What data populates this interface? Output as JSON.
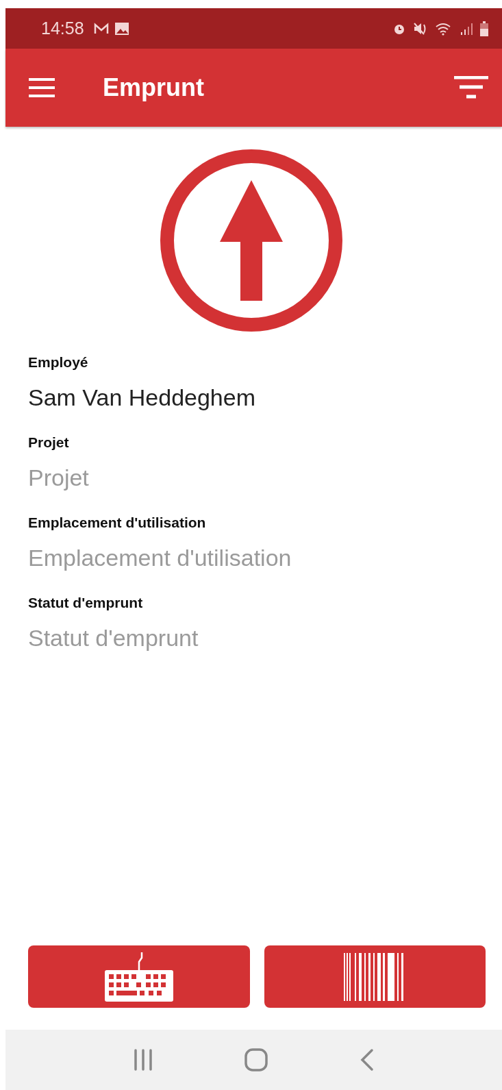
{
  "status_bar": {
    "time": "14:58"
  },
  "app_bar": {
    "title": "Emprunt"
  },
  "fields": [
    {
      "label": "Employé",
      "value": "Sam Van Heddeghem"
    },
    {
      "label": "Projet",
      "placeholder": "Projet"
    },
    {
      "label": "Emplacement d'utilisation",
      "placeholder": "Emplacement d'utilisation"
    },
    {
      "label": "Statut d'emprunt",
      "placeholder": "Statut d'emprunt"
    }
  ]
}
